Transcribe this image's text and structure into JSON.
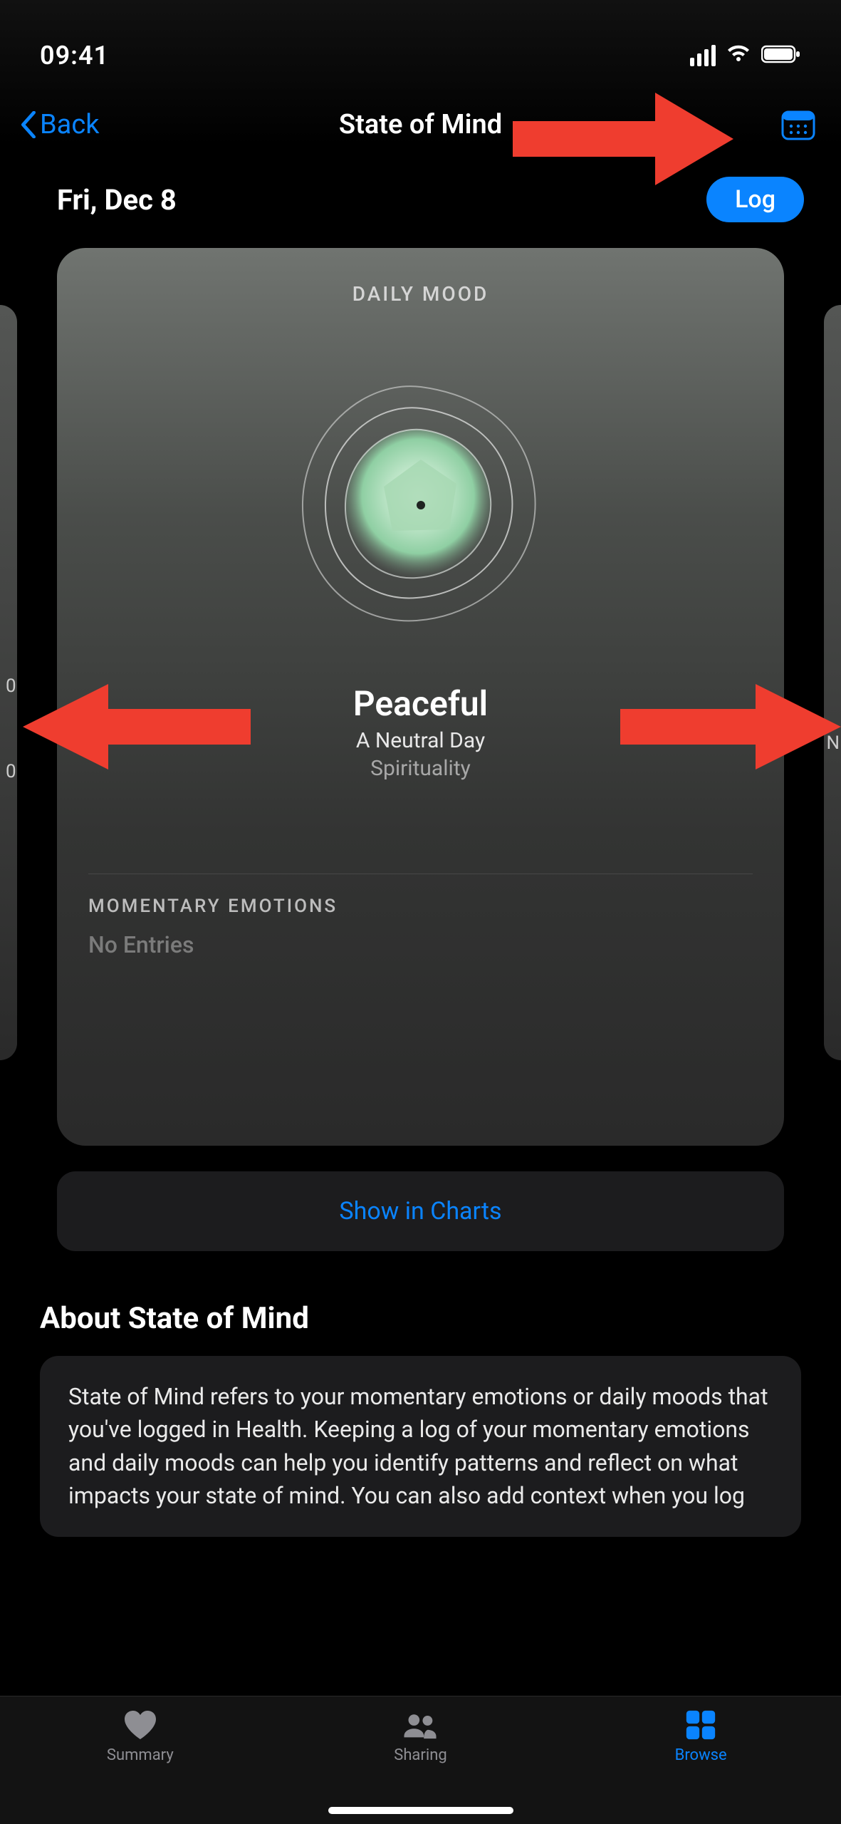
{
  "status": {
    "time": "09:41"
  },
  "nav": {
    "back_label": "Back",
    "title": "State of Mind",
    "calendar_icon": "calendar-icon"
  },
  "date_row": {
    "date": "Fri, Dec 8",
    "log_label": "Log"
  },
  "mood_card": {
    "kicker": "DAILY MOOD",
    "mood_name": "Peaceful",
    "mood_valence": "A Neutral Day",
    "mood_context": "Spirituality",
    "section_label": "MOMENTARY EMOTIONS",
    "no_entries": "No Entries"
  },
  "charts_btn_label": "Show in Charts",
  "about": {
    "title": "About State of Mind",
    "body": "State of Mind refers to your momentary emotions or daily moods that you've logged in Health. Keeping a log of your momentary emotions and daily moods can help you identify patterns and reflect on what impacts your state of mind. You can also add context when you log"
  },
  "tabs": {
    "summary": "Summary",
    "sharing": "Sharing",
    "browse": "Browse"
  },
  "colors": {
    "blue": "#0a84ff",
    "arrow": "#ef3d2f"
  }
}
